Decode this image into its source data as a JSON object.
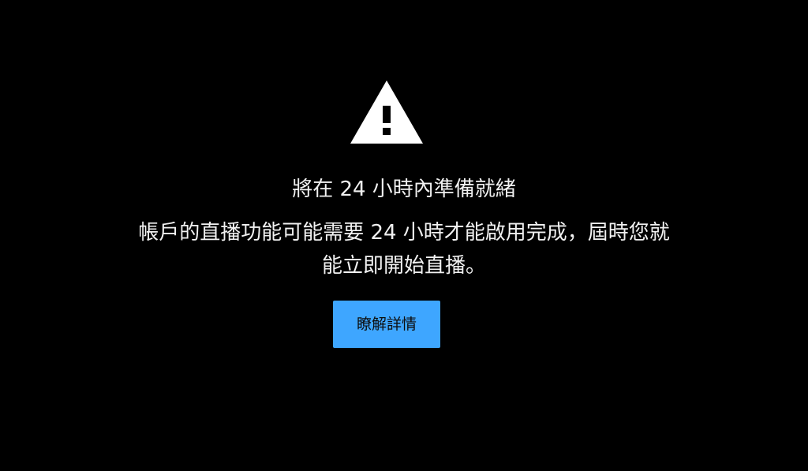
{
  "dialog": {
    "icon": "warning-icon",
    "title": "將在 24 小時內準備就緒",
    "message_lines": [
      "帳戶的直播功能可能需要 24 小時才能啟用完成，屆時您就",
      "能立即開始直播。"
    ],
    "learn_more_label": "瞭解詳情"
  },
  "colors": {
    "background": "#000000",
    "text": "#f1f1f1",
    "icon": "#ffffff",
    "button_background": "#3ea6ff",
    "button_text": "#0d0d0d"
  }
}
